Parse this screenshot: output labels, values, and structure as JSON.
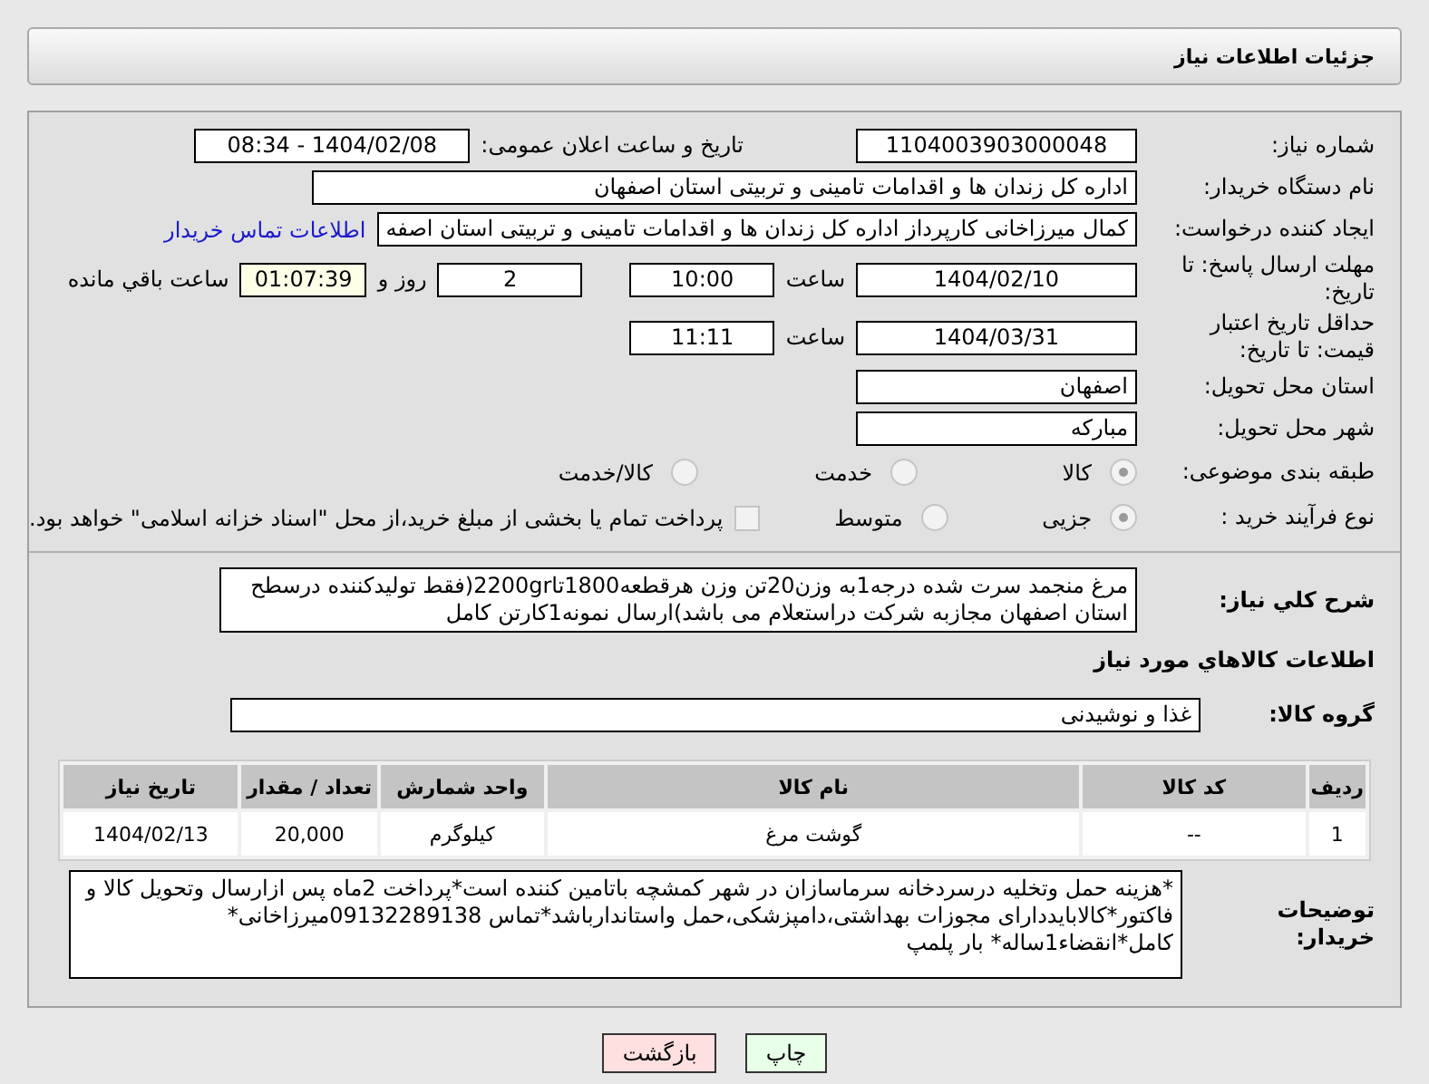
{
  "header": {
    "title": "جزئیات اطلاعات نیاز"
  },
  "need_number": {
    "label": "شماره نیاز:",
    "value": "1104003903000048"
  },
  "announce": {
    "label": "تاریخ و ساعت اعلان عمومی:",
    "value": "1404/02/08 - 08:34"
  },
  "buyer": {
    "label": "نام دستگاه خریدار:",
    "value": "اداره کل زندان ها و اقدامات تامینی و تربیتی استان اصفهان"
  },
  "requester": {
    "label": "ایجاد کننده درخواست:",
    "value": "کمال میرزاخانی کارپرداز اداره کل زندان ها و اقدامات تامینی و تربیتی استان اصفه",
    "link": "اطلاعات تماس خریدار"
  },
  "deadline": {
    "label": "مهلت ارسال پاسخ: تا تاریخ:",
    "date": "1404/02/10",
    "time_label": "ساعت",
    "time": "10:00",
    "days": "2",
    "days_label": "روز و",
    "remaining": "01:07:39",
    "remaining_label": "ساعت باقي مانده"
  },
  "validity": {
    "label": "حداقل تاریخ اعتبار قیمت: تا تاریخ:",
    "date": "1404/03/31",
    "time_label": "ساعت",
    "time": "11:11"
  },
  "province": {
    "label": "استان محل تحویل:",
    "value": "اصفهان"
  },
  "city": {
    "label": "شهر محل تحویل:",
    "value": "مبارکه"
  },
  "category": {
    "label": "طبقه بندی موضوعی:",
    "options": [
      {
        "label": "کالا",
        "selected": true
      },
      {
        "label": "خدمت",
        "selected": false
      },
      {
        "label": "کالا/خدمت",
        "selected": false
      }
    ]
  },
  "process": {
    "label": "نوع فرآیند خرید :",
    "options": [
      {
        "label": "جزیی",
        "selected": true
      },
      {
        "label": "متوسط",
        "selected": false
      }
    ],
    "treasury": {
      "label": "پرداخت تمام یا بخشی از مبلغ خرید،از محل \"اسناد خزانه اسلامی\" خواهد بود.",
      "checked": false
    }
  },
  "description": {
    "label": "شرح کلي نياز:",
    "text": "مرغ منجمد سرت شده درجه1به وزن20تن وزن هرقطعه1800تا2200gr(فقط تولیدکننده درسطح استان اصفهان مجازبه شرکت دراستعلام می باشد)ارسال نمونه1کارتن کامل"
  },
  "goods_heading": "اطلاعات کالاهاي مورد نياز",
  "goods_group": {
    "label": "گروه کالا:",
    "value": "غذا و نوشیدنی"
  },
  "table": {
    "columns": [
      "ردیف",
      "کد کالا",
      "نام کالا",
      "واحد شمارش",
      "تعداد / مقدار",
      "تاریخ نیاز"
    ],
    "rows": [
      [
        "1",
        "--",
        "گوشت مرغ",
        "کیلوگرم",
        "20,000",
        "1404/02/13"
      ]
    ]
  },
  "buyer_notes": {
    "label": "توضیحات خریدار:",
    "text": "*هزینه حمل وتخلیه درسردخانه سرماسازان در شهر کمشچه باتامین کننده است*پرداخت 2ماه پس ازارسال وتحویل کالا و فاکتور*کالابایددارای مجوزات بهداشتی،دامپزشکی،حمل واستاندارباشد*تماس 09132289138میرزاخانی*\nکامل*انقضاء1ساله* بار پلمپ"
  },
  "buttons": [
    {
      "label": "چاپ",
      "kind": "print"
    },
    {
      "label": "بازگشت",
      "kind": "back"
    }
  ]
}
